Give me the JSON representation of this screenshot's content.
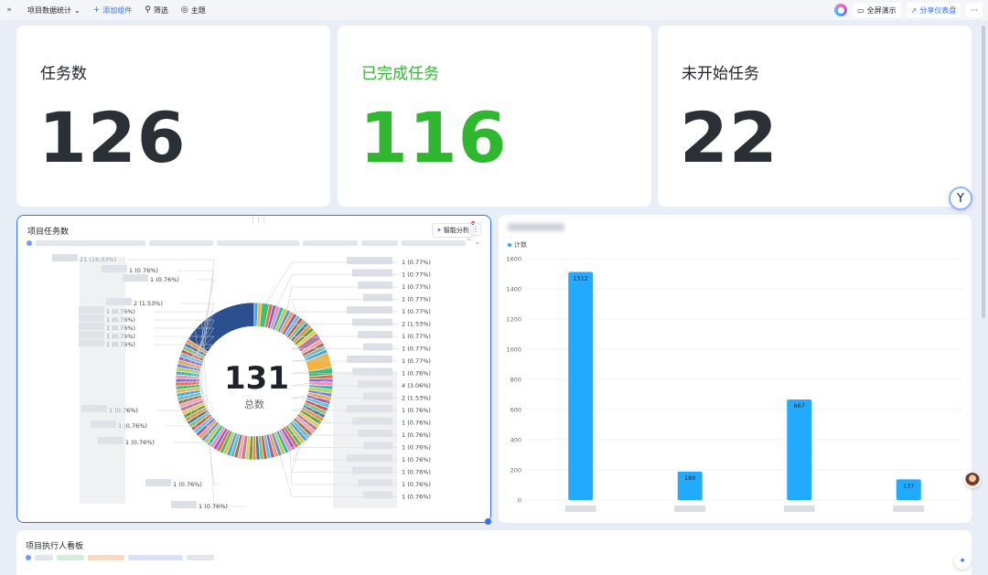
{
  "toolbar": {
    "collapse_icon": "expand-icon",
    "dashboard_title": "项目数据统计",
    "add_component": "添加组件",
    "filter": "筛选",
    "theme": "主题",
    "fullscreen": "全屏演示",
    "share": "分享仪表盘"
  },
  "stats": [
    {
      "label": "任务数",
      "value": "126",
      "color": "#2b2f36"
    },
    {
      "label": "已完成任务",
      "value": "116",
      "color": "#2fb72f"
    },
    {
      "label": "未开始任务",
      "value": "22",
      "color": "#2b2f36"
    }
  ],
  "donut_panel": {
    "title": "项目任务数",
    "smart_analysis": "智能分析",
    "center_value": "131",
    "center_label": "总数",
    "chart_data": {
      "type": "pie",
      "total": 131,
      "slices_left": [
        {
          "label": "21 (16.03%)",
          "value": 21
        },
        {
          "label": "1 (0.76%)",
          "value": 1
        },
        {
          "label": "1 (0.76%)",
          "value": 1
        },
        {
          "label": "2 (1.53%)",
          "value": 2
        },
        {
          "label": "1 (0.76%)",
          "value": 1
        },
        {
          "label": "1 (0.76%)",
          "value": 1
        },
        {
          "label": "1 (0.76%)",
          "value": 1
        },
        {
          "label": "1 (0.76%)",
          "value": 1
        },
        {
          "label": "1 (0.76%)",
          "value": 1
        },
        {
          "label": "1 (0.76%)",
          "value": 1
        },
        {
          "label": "1 (0.76%)",
          "value": 1
        },
        {
          "label": "1 (0.76%)",
          "value": 1
        },
        {
          "label": "1 (0.76%)",
          "value": 1
        },
        {
          "label": "1 (0.76%)",
          "value": 1
        }
      ],
      "slices_right": [
        {
          "label": "1 (0.77%)",
          "value": 1
        },
        {
          "label": "1 (0.77%)",
          "value": 1
        },
        {
          "label": "1 (0.77%)",
          "value": 1
        },
        {
          "label": "1 (0.77%)",
          "value": 1
        },
        {
          "label": "1 (0.77%)",
          "value": 1
        },
        {
          "label": "2 (1.53%)",
          "value": 2
        },
        {
          "label": "1 (0.77%)",
          "value": 1
        },
        {
          "label": "1 (0.77%)",
          "value": 1
        },
        {
          "label": "1 (0.77%)",
          "value": 1
        },
        {
          "label": "1 (0.76%)",
          "value": 1
        },
        {
          "label": "4 (3.06%)",
          "value": 4
        },
        {
          "label": "2 (1.53%)",
          "value": 2
        },
        {
          "label": "1 (0.76%)",
          "value": 1
        },
        {
          "label": "1 (0.76%)",
          "value": 1
        },
        {
          "label": "1 (0.76%)",
          "value": 1
        },
        {
          "label": "1 (0.76%)",
          "value": 1
        },
        {
          "label": "1 (0.76%)",
          "value": 1
        },
        {
          "label": "1 (0.76%)",
          "value": 1
        },
        {
          "label": "1 (0.76%)",
          "value": 1
        },
        {
          "label": "1 (0.76%)",
          "value": 1
        }
      ]
    }
  },
  "bar_panel": {
    "legend": "计数",
    "chart_data": {
      "type": "bar",
      "categories": [
        "",
        "",
        "",
        ""
      ],
      "values": [
        1512,
        189,
        667,
        137
      ],
      "ylim": [
        0,
        1600
      ],
      "yticks": [
        0,
        200,
        400,
        600,
        800,
        1000,
        1200,
        1400,
        1600
      ],
      "bar_color": "#22aafe",
      "grid": true
    }
  },
  "bottom_panel": {
    "title": "项目执行人看板"
  }
}
